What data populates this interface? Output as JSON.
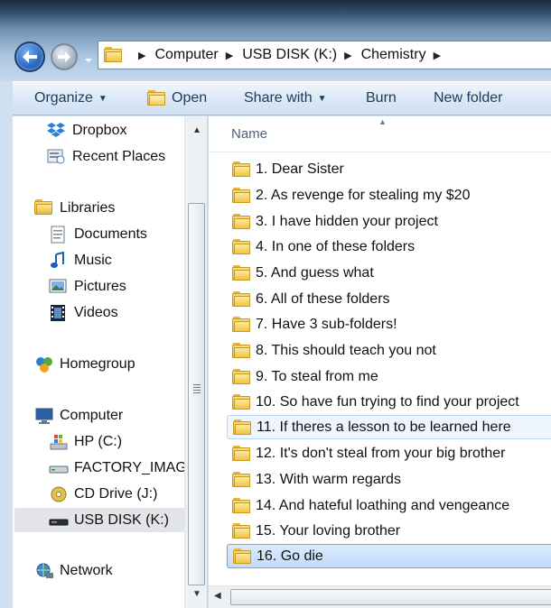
{
  "address": {
    "crumbs": [
      "Computer",
      "USB DISK (K:)",
      "Chemistry"
    ]
  },
  "toolbar": {
    "organize": "Organize",
    "open": "Open",
    "share_with": "Share with",
    "burn": "Burn",
    "new_folder": "New folder"
  },
  "navigation": {
    "dropbox": "Dropbox",
    "recent_places": "Recent Places",
    "libraries": "Libraries",
    "documents": "Documents",
    "music": "Music",
    "pictures": "Pictures",
    "videos": "Videos",
    "homegroup": "Homegroup",
    "computer": "Computer",
    "hp_c": "HP (C:)",
    "factory_image": "FACTORY_IMAGI",
    "cd_drive": "CD Drive (J:)",
    "usb_disk": "USB DISK (K:)",
    "network": "Network"
  },
  "file_list": {
    "column_name": "Name",
    "items": [
      "1. Dear Sister",
      "2. As revenge for stealing my $20",
      "3. I have hidden your project",
      "4. In one of these folders",
      "5. And guess what",
      "6. All of these folders",
      "7. Have 3 sub-folders!",
      "8. This should teach you not",
      "9. To steal from me",
      "10. So have fun trying to find your project",
      "11. If theres a lesson to be learned here",
      "12. It's don't steal from your big brother",
      "13. With warm regards",
      "14. And hateful loathing and vengeance",
      "15. Your loving brother",
      "16. Go die"
    ]
  },
  "colors": {
    "selection": "#c1dbfc",
    "toolbar_text": "#1e395b"
  }
}
